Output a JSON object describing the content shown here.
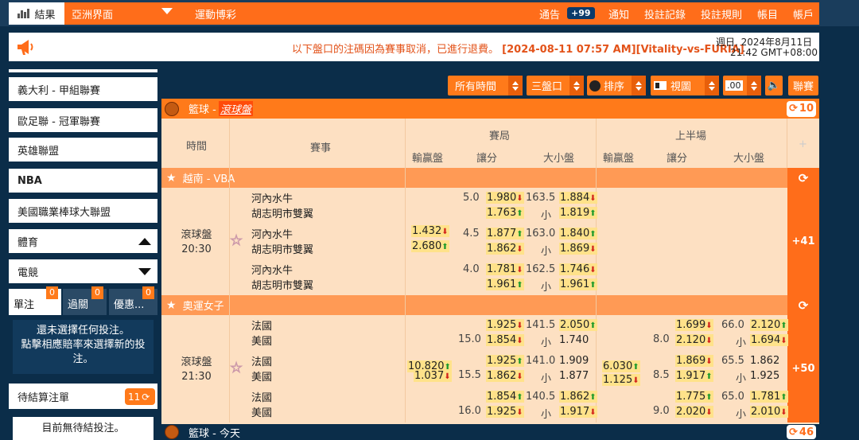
{
  "topbar": {
    "results_label": "結果",
    "region": "亞洲界面",
    "sports": "運動博彩",
    "announce": "通告",
    "announce_count": "+99",
    "notify": "通知",
    "bet_record": "投註記錄",
    "bet_rules": "投註規則",
    "account_menu": "帳目",
    "account": "帳戶"
  },
  "notice": {
    "text": "以下盤口的注碼因為賽事取消，已進行退費。",
    "detail": "[2024-08-11 07:57 AM][Vitality-vs-FURIA]",
    "date": "週日, 2024年8月11日",
    "time": "21:42 GMT+08:00"
  },
  "sidebar": {
    "items": [
      "義大利 - 甲組聯賽",
      "歐足聯 - 冠軍聯賽",
      "英雄聯盟",
      "NBA",
      "美國職業棒球大聯盟"
    ],
    "sports_label": "體育",
    "esports_label": "電競"
  },
  "betslip": {
    "tabs": [
      {
        "label": "單注",
        "count": "0"
      },
      {
        "label": "過關",
        "count": "0"
      },
      {
        "label": "優惠...",
        "count": "0"
      }
    ],
    "empty_line1": "還未選擇任何投注。",
    "empty_line2": "點擊相應賠率來選擇新的投",
    "empty_line3": "注。",
    "pending_label": "待結算注單",
    "pending_count": "11",
    "no_pending": "目前無待結投注。"
  },
  "toolbar": {
    "time_filter": "所有時間",
    "market_filter": "三盤口",
    "sort": "排序",
    "view": "視圖",
    "odds_format": ".00",
    "sound": "",
    "league": "聯賽"
  },
  "section": {
    "title": "籃球 - ",
    "badge": "滾球盤",
    "count": "10"
  },
  "headers": {
    "time": "時間",
    "match": "賽事",
    "full": "賽局",
    "half": "上半場",
    "ml": "輸贏盤",
    "hdp": "讓分",
    "ou": "大小盤",
    "plus": "+"
  },
  "leagues": [
    {
      "name": "越南 - VBA",
      "status": "滾球盤",
      "clock": "20:30",
      "more": "+41",
      "rows": [
        {
          "home": "河內水牛",
          "away": "胡志明市雙翼",
          "hdp": "5.0",
          "hdp_home": "1.980",
          "hdp_away": "1.763",
          "ou": "163.5",
          "ou_u": "小",
          "ou_over": "1.884",
          "ou_under": "1.819"
        },
        {
          "home": "河內水牛",
          "away": "胡志明市雙翼",
          "ml_home": "1.432",
          "ml_away": "2.680",
          "hdp": "4.5",
          "hdp_home": "1.877",
          "hdp_away": "1.862",
          "ou": "163.0",
          "ou_u": "小",
          "ou_over": "1.840",
          "ou_under": "1.869"
        },
        {
          "home": "河內水牛",
          "away": "胡志明市雙翼",
          "hdp": "4.0",
          "hdp_home": "1.781",
          "hdp_away": "1.961",
          "ou": "162.5",
          "ou_u": "小",
          "ou_over": "1.746",
          "ou_under": "1.961"
        }
      ]
    },
    {
      "name": "奧運女子",
      "status": "滾球盤",
      "clock": "21:30",
      "more": "+50",
      "rows": [
        {
          "home": "法國",
          "away": "美國",
          "hdp": "15.0",
          "hdp_home": "1.925",
          "hdp_away": "1.854",
          "ou": "141.5",
          "ou_u": "小",
          "ou_over": "2.050",
          "ou_under": "1.740",
          "h_hdp": "8.0",
          "h_hdp_home": "1.699",
          "h_hdp_away": "2.120",
          "h_ou": "66.0",
          "h_ou_u": "小",
          "h_ou_over": "2.120",
          "h_ou_under": "1.694"
        },
        {
          "home": "法國",
          "away": "美國",
          "ml_home": "10.820",
          "ml_away": "1.037",
          "hdp": "15.5",
          "hdp_home": "1.925",
          "hdp_away": "1.862",
          "ou": "141.0",
          "ou_u": "小",
          "ou_over": "1.909",
          "ou_under": "1.877",
          "h_ml_home": "6.030",
          "h_ml_away": "1.125",
          "h_hdp": "8.5",
          "h_hdp_home": "1.869",
          "h_hdp_away": "1.917",
          "h_ou": "65.5",
          "h_ou_u": "小",
          "h_ou_over": "1.862",
          "h_ou_under": "1.925"
        },
        {
          "home": "法國",
          "away": "美國",
          "hdp": "16.0",
          "hdp_home": "1.854",
          "hdp_away": "1.925",
          "ou": "140.5",
          "ou_u": "小",
          "ou_over": "1.862",
          "ou_under": "1.917",
          "h_hdp": "9.0",
          "h_hdp_home": "1.775",
          "h_hdp_away": "2.020",
          "h_ou": "65.0",
          "h_ou_u": "小",
          "h_ou_over": "1.781",
          "h_ou_under": "2.010"
        }
      ]
    }
  ],
  "bottom_section": {
    "title": "籃球 - 今天",
    "count": "46"
  }
}
